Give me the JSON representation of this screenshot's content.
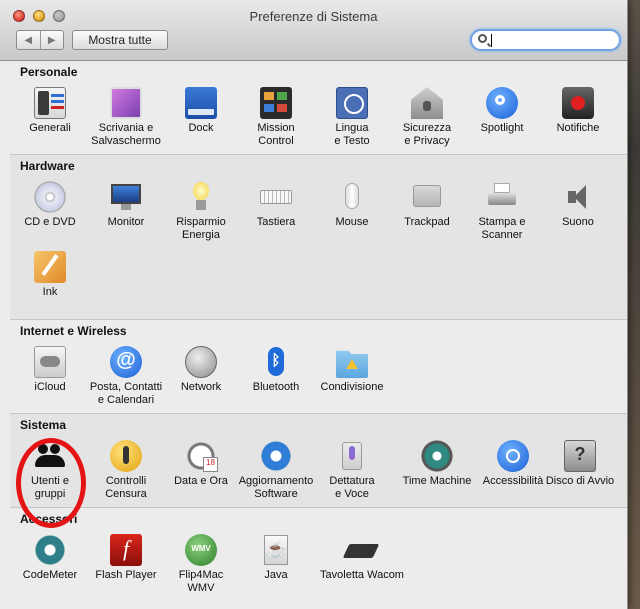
{
  "window": {
    "title": "Preferenze di Sistema"
  },
  "toolbar": {
    "back": "◀",
    "forward": "▶",
    "show_all": "Mostra tutte",
    "search_value": ""
  },
  "sections": {
    "personale": {
      "title": "Personale",
      "items": [
        "Generali",
        "Scrivania e\nSalvaschermo",
        "Dock",
        "Mission\nControl",
        "Lingua\ne Testo",
        "Sicurezza\ne Privacy",
        "Spotlight",
        "Notifiche"
      ]
    },
    "hardware": {
      "title": "Hardware",
      "items": [
        "CD e DVD",
        "Monitor",
        "Risparmio\nEnergia",
        "Tastiera",
        "Mouse",
        "Trackpad",
        "Stampa e\nScanner",
        "Suono",
        "Ink"
      ]
    },
    "internet": {
      "title": "Internet e Wireless",
      "items": [
        "iCloud",
        "Posta, Contatti\ne Calendari",
        "Network",
        "Bluetooth",
        "Condivisione"
      ]
    },
    "sistema": {
      "title": "Sistema",
      "items": [
        "Utenti e\ngruppi",
        "Controlli\nCensura",
        "Data e Ora",
        "Aggiornamento\nSoftware",
        "Dettatura\ne Voce",
        "Time Machine",
        "Accessibilità",
        "Disco di Avvio"
      ]
    },
    "accessori": {
      "title": "Accessori",
      "items": [
        "CodeMeter",
        "Flash Player",
        "Flip4Mac\nWMV",
        "Java",
        "Tavoletta Wacom"
      ]
    }
  },
  "highlight_color": "#e41414"
}
